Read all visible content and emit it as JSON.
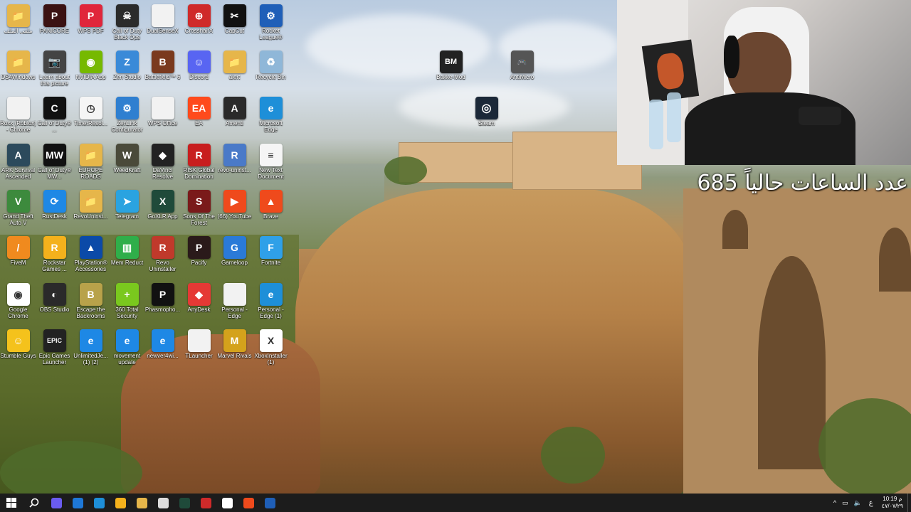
{
  "desktop_icons": [
    {
      "label": "ملفي الملف",
      "color": "#e6b64a",
      "glyph": "📁",
      "icon": "folder-icon"
    },
    {
      "label": "PANICORE",
      "color": "#3b1212",
      "glyph": "P",
      "icon": "panicore-icon"
    },
    {
      "label": "WPS PDF",
      "color": "#e0263b",
      "glyph": "P",
      "icon": "wps-pdf-icon"
    },
    {
      "label": "Call of Duty Black Ops",
      "color": "#2b2b2b",
      "glyph": "☠",
      "icon": "call-of-duty-icon"
    },
    {
      "label": "DualSenseX",
      "color": "#f2f2f2",
      "glyph": "",
      "icon": "file-icon"
    },
    {
      "label": "CrosshairX",
      "color": "#cf2a2a",
      "glyph": "⊕",
      "icon": "crosshair-icon"
    },
    {
      "label": "CapCut",
      "color": "#111111",
      "glyph": "✂",
      "icon": "capcut-icon"
    },
    {
      "label": "Rocket League®",
      "color": "#1f5fb8",
      "glyph": "⚙",
      "icon": "rocket-league-icon"
    },
    {
      "label": "DS4Windows",
      "color": "#e6b64a",
      "glyph": "📁",
      "icon": "folder-icon"
    },
    {
      "label": "Learn about this picture",
      "color": "#444444",
      "glyph": "📷",
      "icon": "camera-icon"
    },
    {
      "label": "NVIDIA App",
      "color": "#76b900",
      "glyph": "◉",
      "icon": "nvidia-icon"
    },
    {
      "label": "Zen Studio",
      "color": "#3a8ad8",
      "glyph": "Z",
      "icon": "zen-studio-icon"
    },
    {
      "label": "Battlefield™ 6",
      "color": "#7a3a1e",
      "glyph": "B",
      "icon": "battlefield-icon"
    },
    {
      "label": "Discord",
      "color": "#5865f2",
      "glyph": "☺",
      "icon": "discord-icon"
    },
    {
      "label": "alert",
      "color": "#e6b64a",
      "glyph": "📁",
      "icon": "folder-icon"
    },
    {
      "label": "Recycle Bin",
      "color": "#8fb7d8",
      "glyph": "♻",
      "icon": "recycle-bin-icon"
    },
    {
      "label": "Roxx (Roblox) - Chrome",
      "color": "#f2f2f2",
      "glyph": "",
      "icon": "file-icon"
    },
    {
      "label": "Call of Duty® ...",
      "color": "#111111",
      "glyph": "C",
      "icon": "call-of-duty-icon"
    },
    {
      "label": "TimerResol...",
      "color": "#f5f5f5",
      "glyph": "◷",
      "icon": "clock-icon"
    },
    {
      "label": "ZenLink Configurator",
      "color": "#2f7fd0",
      "glyph": "⚙",
      "icon": "zenlink-icon"
    },
    {
      "label": "WPS Office",
      "color": "#f2f2f2",
      "glyph": "",
      "icon": "file-icon"
    },
    {
      "label": "EA",
      "color": "#ff4a1c",
      "glyph": "EA",
      "icon": "ea-icon"
    },
    {
      "label": "Amenti",
      "color": "#2a2a2a",
      "glyph": "A",
      "icon": "amenti-icon"
    },
    {
      "label": "Microsoft Edge",
      "color": "#1e8fd8",
      "glyph": "e",
      "icon": "edge-icon"
    },
    {
      "label": "ARK Survival Ascended",
      "color": "#2c4a5c",
      "glyph": "A",
      "icon": "ark-icon"
    },
    {
      "label": "Call of Duty® MW...",
      "color": "#111111",
      "glyph": "MW",
      "icon": "call-of-duty-icon"
    },
    {
      "label": "EUROPE ROADS",
      "color": "#e6b64a",
      "glyph": "📁",
      "icon": "folder-icon"
    },
    {
      "label": "WeedKraft",
      "color": "#4a4a3a",
      "glyph": "W",
      "icon": "weedcraft-icon"
    },
    {
      "label": "DaVinci Resolve",
      "color": "#222222",
      "glyph": "◆",
      "icon": "davinci-icon"
    },
    {
      "label": "RISK Global Domination",
      "color": "#c81e1e",
      "glyph": "R",
      "icon": "risk-icon"
    },
    {
      "label": "revo-uninst...",
      "color": "#4a7ac8",
      "glyph": "R",
      "icon": "installer-icon"
    },
    {
      "label": "New Text Document",
      "color": "#f5f5f5",
      "glyph": "≡",
      "icon": "text-file-icon"
    },
    {
      "label": "Grand Theft Auto V",
      "color": "#3d8a3d",
      "glyph": "V",
      "icon": "gta-icon"
    },
    {
      "label": "RustDesk",
      "color": "#1e88e5",
      "glyph": "⟳",
      "icon": "rustdesk-icon"
    },
    {
      "label": "RevoUninst...",
      "color": "#e6b64a",
      "glyph": "📁",
      "icon": "folder-icon"
    },
    {
      "label": "Telegram",
      "color": "#2aa3e0",
      "glyph": "➤",
      "icon": "telegram-icon"
    },
    {
      "label": "GoXLR App",
      "color": "#1f4a3a",
      "glyph": "X",
      "icon": "goxlr-icon"
    },
    {
      "label": "Sons Of The Forest",
      "color": "#7a1a1a",
      "glyph": "S",
      "icon": "sons-forest-icon"
    },
    {
      "label": "(66) YouTube",
      "color": "#ef4a1c",
      "glyph": "▶",
      "icon": "brave-icon"
    },
    {
      "label": "Brave",
      "color": "#ef4a1c",
      "glyph": "▲",
      "icon": "brave-icon"
    },
    {
      "label": "FiveM",
      "color": "#f08a1e",
      "glyph": "/",
      "icon": "fivem-icon"
    },
    {
      "label": "Rockstar Games ...",
      "color": "#f4b11c",
      "glyph": "R",
      "icon": "rockstar-icon"
    },
    {
      "label": "PlayStation® Accessories",
      "color": "#0b4aa8",
      "glyph": "▲",
      "icon": "playstation-icon"
    },
    {
      "label": "Mem Reduct",
      "color": "#2fae4a",
      "glyph": "▥",
      "icon": "mem-reduct-icon"
    },
    {
      "label": "Revo Uninstaller",
      "color": "#c0392b",
      "glyph": "R",
      "icon": "revo-icon"
    },
    {
      "label": "Pacify",
      "color": "#2a1a1a",
      "glyph": "P",
      "icon": "pacify-icon"
    },
    {
      "label": "Gameloop",
      "color": "#2a7ad8",
      "glyph": "G",
      "icon": "gameloop-icon"
    },
    {
      "label": "Fortnite",
      "color": "#2fa0e8",
      "glyph": "F",
      "icon": "fortnite-icon"
    },
    {
      "label": "Google Chrome",
      "color": "#ffffff",
      "glyph": "◉",
      "icon": "chrome-icon"
    },
    {
      "label": "OBS Studio",
      "color": "#2a2a2a",
      "glyph": "◐",
      "icon": "obs-icon"
    },
    {
      "label": "Escape the Backrooms",
      "color": "#b8a24a",
      "glyph": "B",
      "icon": "backrooms-icon"
    },
    {
      "label": "360 Total Security",
      "color": "#7ac81e",
      "glyph": "+",
      "icon": "security-icon"
    },
    {
      "label": "Phasmopho...",
      "color": "#111111",
      "glyph": "P",
      "icon": "phasmophobia-icon"
    },
    {
      "label": "AnyDesk",
      "color": "#e53935",
      "glyph": "◆",
      "icon": "anydesk-icon"
    },
    {
      "label": "Personal - Edge",
      "color": "#f2f2f2",
      "glyph": "",
      "icon": "file-icon"
    },
    {
      "label": "Personal - Edge (1)",
      "color": "#1e8fd8",
      "glyph": "e",
      "icon": "edge-icon"
    },
    {
      "label": "Stumble Guys",
      "color": "#f4c21c",
      "glyph": "☺",
      "icon": "stumble-guys-icon"
    },
    {
      "label": "Epic Games Launcher",
      "color": "#222222",
      "glyph": "EPIC",
      "icon": "epic-games-icon"
    },
    {
      "label": "UnlimitedJe... (1) (2)",
      "color": "#1e88e5",
      "glyph": "e",
      "icon": "ie-icon"
    },
    {
      "label": "movement update",
      "color": "#1e88e5",
      "glyph": "e",
      "icon": "ie-icon"
    },
    {
      "label": "newver4wi...",
      "color": "#1e88e5",
      "glyph": "e",
      "icon": "ie-icon"
    },
    {
      "label": "TLauncher",
      "color": "#f2f2f2",
      "glyph": "",
      "icon": "file-icon"
    },
    {
      "label": "Marvel Rivals",
      "color": "#d4a21c",
      "glyph": "M",
      "icon": "marvel-rivals-icon"
    },
    {
      "label": "XboxInstaller (1)",
      "color": "#ffffff",
      "glyph": "X",
      "icon": "xbox-icon"
    }
  ],
  "extra_icons": [
    {
      "label": "Bakke-Mod",
      "color": "#222222",
      "glyph": "BM",
      "icon": "bakkesmod-icon"
    },
    {
      "label": "AntiMicro",
      "color": "#555555",
      "glyph": "🎮",
      "icon": "gamepad-icon"
    },
    {
      "label": "Steam",
      "color": "#1b2838",
      "glyph": "◎",
      "icon": "steam-icon"
    }
  ],
  "overlay": {
    "text": "عدد الساعات حالياً 685"
  },
  "taskbar": {
    "apps": [
      {
        "icon": "copilot-icon",
        "color": "#6a5cf0"
      },
      {
        "icon": "outlook-icon",
        "color": "#1e78d8"
      },
      {
        "icon": "edge-icon",
        "color": "#1e8fd8"
      },
      {
        "icon": "store-icon",
        "color": "#f4b11c"
      },
      {
        "icon": "file-explorer-icon",
        "color": "#e6b64a"
      },
      {
        "icon": "settings-icon",
        "color": "#dddddd"
      },
      {
        "icon": "goxlr-icon",
        "color": "#1f4a3a"
      },
      {
        "icon": "crosshair-icon",
        "color": "#cf2a2a"
      },
      {
        "icon": "chrome-icon",
        "color": "#ffffff"
      },
      {
        "icon": "brave-icon",
        "color": "#ef4a1c"
      },
      {
        "icon": "rocket-league-icon",
        "color": "#1f5fb8"
      }
    ],
    "tray": {
      "lang": "ع",
      "time": "10:19 م",
      "date": "٤٧/٠٧/٢٩"
    }
  }
}
